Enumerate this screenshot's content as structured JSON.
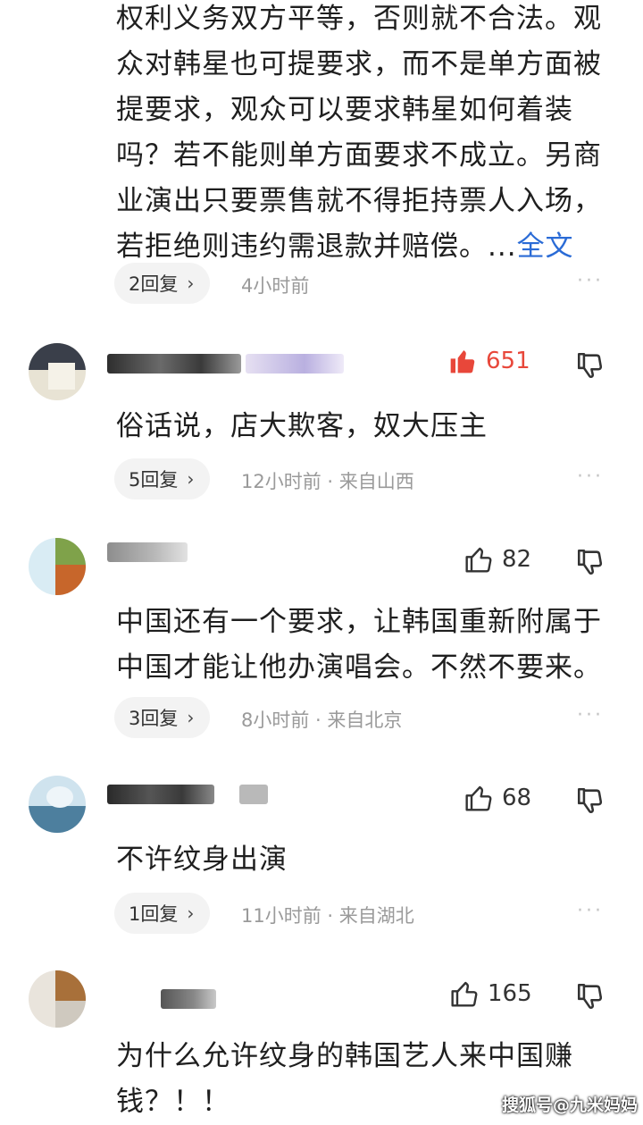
{
  "first_comment": {
    "lines": [
      "权利义务双方平等，否则就不合法。观",
      "众对韩星也可提要求，而不是单方面被",
      "提要求，观众可以要求韩星如何着装",
      "吗？若不能则单方面要求不成立。另商",
      "业演出只要票售就不得拒持票人入场，",
      "若拒绝则违约需退款并赔偿。..."
    ],
    "more_label": "全文",
    "replies": "2回复",
    "time": "4小时前"
  },
  "comments": [
    {
      "likes": "651",
      "liked": true,
      "lines": [
        "俗话说，店大欺客，奴大压主"
      ],
      "replies": "5回复",
      "meta": "12小时前 · 来自山西"
    },
    {
      "likes": "82",
      "liked": false,
      "lines": [
        "中国还有一个要求，让韩国重新附属于",
        "中国才能让他办演唱会。不然不要来。"
      ],
      "replies": "3回复",
      "meta": "8小时前 · 来自北京"
    },
    {
      "likes": "68",
      "liked": false,
      "lines": [
        "不许纹身出演"
      ],
      "replies": "1回复",
      "meta": "11小时前 · 来自湖北"
    },
    {
      "likes": "165",
      "liked": false,
      "lines": [
        "为什么允许纹身的韩国艺人来中国赚",
        "钱？！！"
      ]
    }
  ],
  "icons": {
    "like": "thumbs-up-icon",
    "dislike": "thumbs-down-icon",
    "more": "more-dots-icon",
    "chevron": "chevron-right-icon"
  },
  "colors": {
    "liked": "#e8473a",
    "link": "#2a6bd6",
    "meta": "#9a9a9a"
  },
  "chevron_glyph": "›",
  "dots_glyph": "···",
  "watermark": "搜狐号@九米妈妈"
}
